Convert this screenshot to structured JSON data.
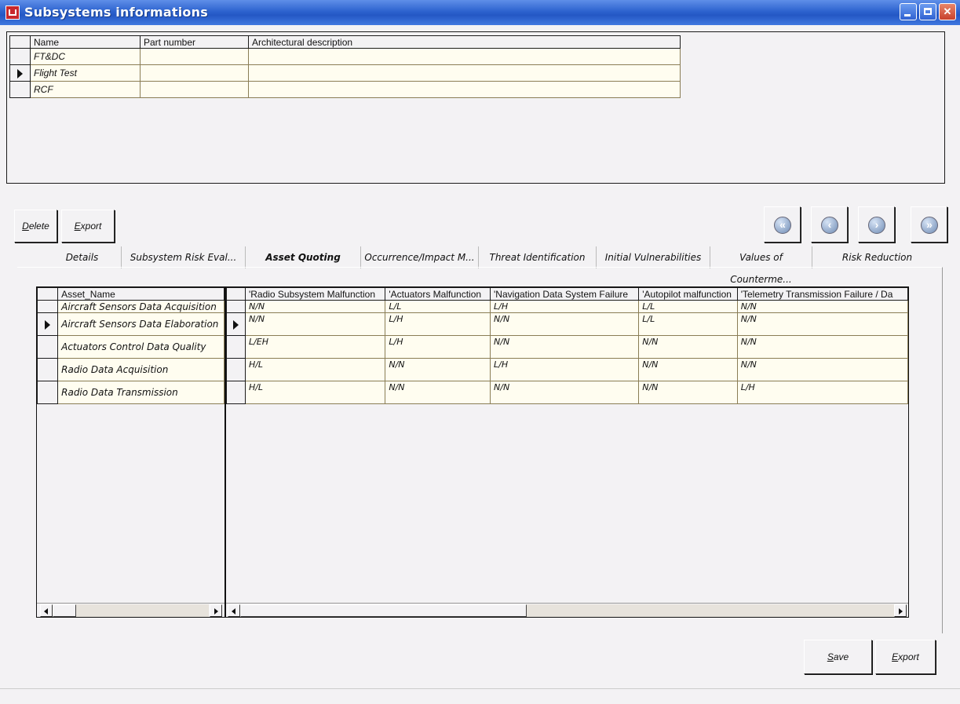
{
  "window": {
    "title": "Subsystems informations"
  },
  "subsystems": {
    "columns": [
      "Name",
      "Part number",
      "Architectural description"
    ],
    "rows": [
      {
        "name": "FT&DC",
        "part_number": "",
        "description": "",
        "selected": false
      },
      {
        "name": "Flight Test",
        "part_number": "",
        "description": "",
        "selected": true
      },
      {
        "name": "RCF",
        "part_number": "",
        "description": "",
        "selected": false
      }
    ]
  },
  "toolbar": {
    "delete_label": "Delete",
    "delete_accel": "D",
    "delete_rest": "elete",
    "export_label": "Export",
    "export_accel": "E",
    "export_rest": "xport"
  },
  "navigation": {
    "icons": [
      "first-record-icon",
      "previous-record-icon",
      "next-record-icon",
      "last-record-icon"
    ]
  },
  "tabs": [
    "Details",
    "Subsystem Risk Eval...",
    "Asset Quoting",
    "Occurrence/Impact M...",
    "Threat Identification",
    "Initial Vulnerabilities",
    "Values of Counterme...",
    "Risk Reduction"
  ],
  "active_tab": "Asset Quoting",
  "assets": {
    "header": "Asset_Name",
    "rows": [
      "Aircraft Sensors Data Acquisition",
      "Aircraft Sensors Data Elaboration",
      "Actuators Control Data Quality",
      "Radio Data Acquisition",
      "Radio Data Transmission"
    ],
    "selected_index": 1
  },
  "quoting": {
    "columns": [
      "'Radio Subsystem Malfunction",
      "'Actuators Malfunction",
      "'Navigation Data System Failure",
      "'Autopilot malfunction",
      "'Telemetry Transmission Failure / Da"
    ],
    "rows": [
      [
        "N/N",
        "L/L",
        "L/H",
        "L/L",
        "N/N"
      ],
      [
        "N/N",
        "L/H",
        "N/N",
        "L/L",
        "N/N"
      ],
      [
        "L/EH",
        "L/H",
        "N/N",
        "N/N",
        "N/N"
      ],
      [
        "H/L",
        "N/N",
        "L/H",
        "N/N",
        "N/N"
      ],
      [
        "H/L",
        "N/N",
        "N/N",
        "N/N",
        "L/H"
      ]
    ],
    "selected_index": 1
  },
  "footer": {
    "save_label": "Save",
    "save_accel": "S",
    "save_rest": "ave",
    "export_label": "Export",
    "export_accel": "E",
    "export_rest": "xport"
  }
}
